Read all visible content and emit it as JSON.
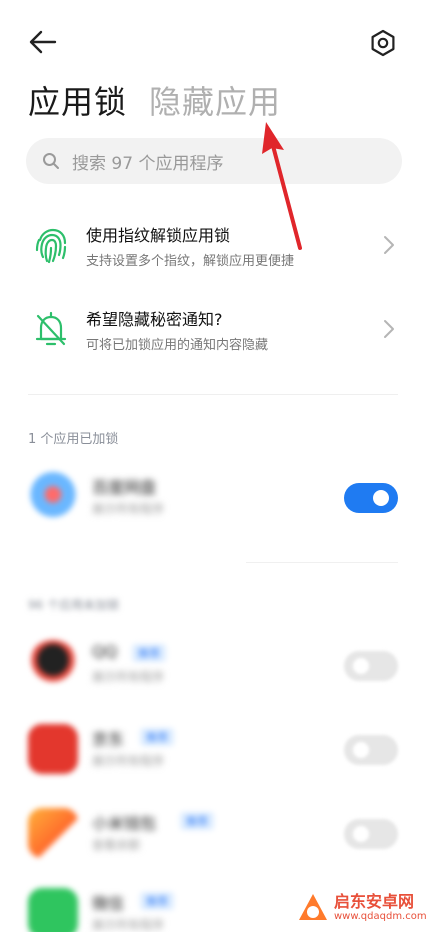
{
  "header": {
    "tab_active": "应用锁",
    "tab_inactive": "隐藏应用"
  },
  "search": {
    "placeholder": "搜索 97 个应用程序"
  },
  "features": [
    {
      "title": "使用指纹解锁应用锁",
      "subtitle": "支持设置多个指纹，解锁应用更便捷"
    },
    {
      "title": "希望隐藏秘密通知?",
      "subtitle": "可将已加锁应用的通知内容隐藏"
    }
  ],
  "locked_section": {
    "label": "1 个应用已加锁",
    "apps": [
      {
        "name": "百度网盘",
        "subtitle": "展示所有程序",
        "enabled": true
      }
    ]
  },
  "unlocked_section": {
    "label": "96 个应用未加锁",
    "apps": [
      {
        "name": "QQ",
        "badge": "推荐",
        "subtitle": "展示所有程序",
        "enabled": false
      },
      {
        "name": "京东",
        "badge": "推荐",
        "subtitle": "展示所有程序",
        "enabled": false
      },
      {
        "name": "小米钱包",
        "badge": "推荐",
        "subtitle": "查看余额",
        "enabled": false
      },
      {
        "name": "微信",
        "badge": "推荐",
        "subtitle": "展示所有程序",
        "enabled": false
      }
    ]
  },
  "watermark": {
    "name": "启东安卓网",
    "url": "www.qdaqdm.com"
  },
  "colors": {
    "accent": "#1f7bf2",
    "fingerprint_icon": "#2dbf6b",
    "annotation_arrow": "#e0262b"
  },
  "icons": {
    "back": "arrow-left-icon",
    "settings": "gear-icon",
    "search": "search-icon",
    "fingerprint": "fingerprint-icon",
    "notification": "bell-icon",
    "chevron": "chevron-right-icon"
  }
}
